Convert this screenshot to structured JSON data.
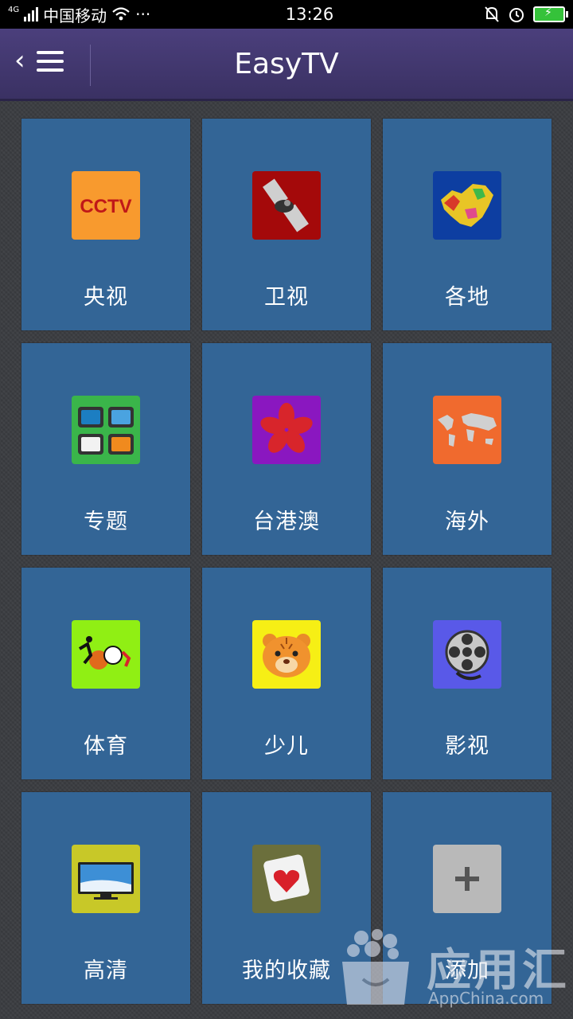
{
  "status_bar": {
    "network": "4G",
    "carrier": "中国移动",
    "dots": "···",
    "time": "13:26"
  },
  "header": {
    "title": "EasyTV",
    "back_icon": "back-menu-icon"
  },
  "tiles": [
    {
      "label": "央视",
      "icon": "cctv-icon",
      "bg": "#f89a2e"
    },
    {
      "label": "卫视",
      "icon": "satellite-icon",
      "bg": "#a4090a"
    },
    {
      "label": "各地",
      "icon": "china-map-icon",
      "bg": "#0d3ea1"
    },
    {
      "label": "专题",
      "icon": "social-tv-icon",
      "bg": "#3ab54a"
    },
    {
      "label": "台港澳",
      "icon": "bauhinia-icon",
      "bg": "#8a17c0"
    },
    {
      "label": "海外",
      "icon": "world-map-icon",
      "bg": "#f06a2e"
    },
    {
      "label": "体育",
      "icon": "sports-icon",
      "bg": "#90ef14"
    },
    {
      "label": "少儿",
      "icon": "tiger-icon",
      "bg": "#f6ef15"
    },
    {
      "label": "影视",
      "icon": "film-reel-icon",
      "bg": "#5959e8"
    },
    {
      "label": "高清",
      "icon": "hd-tv-icon",
      "bg": "#c8c828"
    },
    {
      "label": "我的收藏",
      "icon": "favorite-heart-icon",
      "bg": "#6b6f3c"
    },
    {
      "label": "添加",
      "icon": "plus-icon",
      "bg": "#b9b9b9"
    }
  ],
  "watermark": {
    "text": "应用汇",
    "sub": "AppChina.com"
  }
}
